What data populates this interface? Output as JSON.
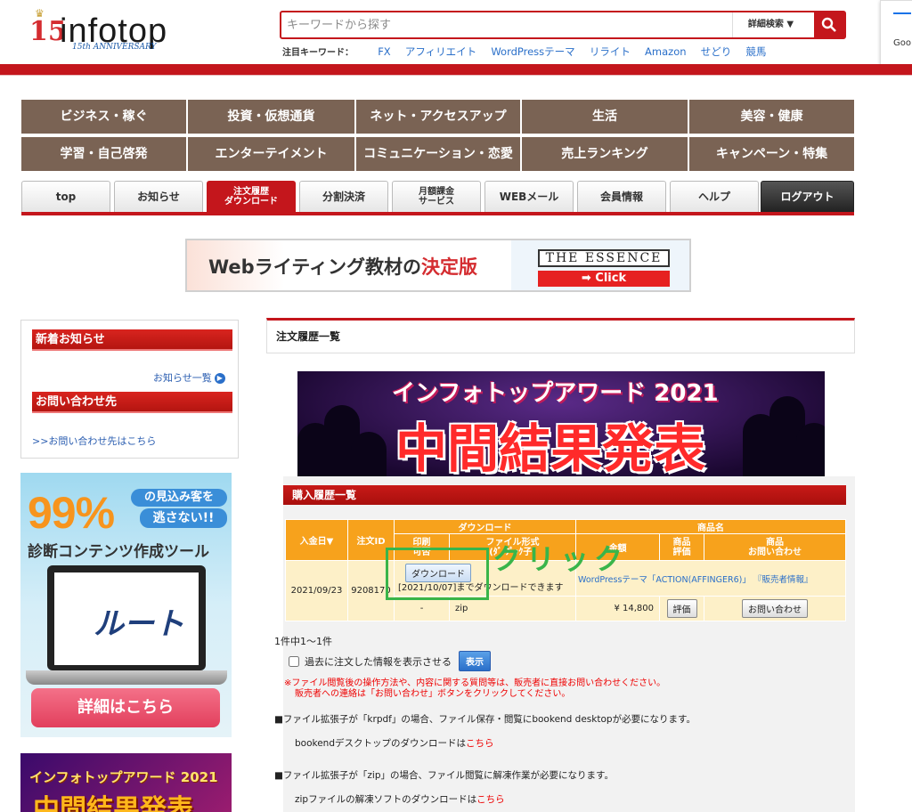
{
  "header": {
    "logo_number": "15",
    "logo_word": "infotop",
    "logo_tagline": "15th ANNIVERSARY",
    "search_placeholder": "キーワードから探す",
    "advanced_search_label": "詳細検索 ▼",
    "keywords_label": "注目キーワード：",
    "keywords": [
      "FX",
      "アフィリエイト",
      "WordPressテーマ",
      "リライト",
      "Amazon",
      "せどり",
      "競馬"
    ],
    "popup_text": "Goo"
  },
  "categories": [
    [
      "ビジネス・稼ぐ",
      "投資・仮想通貨",
      "ネット・アクセスアップ",
      "生活",
      "美容・健康"
    ],
    [
      "学習・自己啓発",
      "エンターテイメント",
      "コミュニケーション・恋愛",
      "売上ランキング",
      "キャンペーン・特集"
    ]
  ],
  "tabs": [
    "top",
    "お知らせ",
    "注文履歴\nダウンロード",
    "分割決済",
    "月額課金\nサービス",
    "WEBメール",
    "会員情報",
    "ヘルプ",
    "ログアウト"
  ],
  "banner": {
    "text_main": "Webライティング教材の",
    "text_red": "決定版",
    "essence": "THE ESSENCE",
    "click": "➡ Click"
  },
  "sidebar": {
    "news_heading": "新着お知らせ",
    "news_link": "お知らせ一覧",
    "contact_heading": "お問い合わせ先",
    "contact_link": ">>お問い合わせ先はこちら"
  },
  "ad1": {
    "big": "99%",
    "line1": "の見込み客を",
    "line2": "逃さない!!",
    "tool": "診断コンテンツ作成ツール",
    "product": "ルート",
    "cta": "詳細はこちら"
  },
  "ad2": {
    "line1": "インフォトップアワード 2021",
    "line2": "中間結果発表"
  },
  "main": {
    "heading": "注文履歴一覧",
    "award_line1": "インフォトップアワード 2021",
    "award_line2": "中間結果発表",
    "panel_heading": "購入履歴一覧",
    "table": {
      "h_date": "入金日▼",
      "h_order": "注文ID",
      "h_download": "ダウンロード",
      "h_product": "商品名",
      "h_print": "印刷\n可否",
      "h_format": "ファイル形式\n(ﾀﾞ ﾌﾟｯｸ子)",
      "h_price": "金額",
      "h_review": "商品\n評価",
      "h_contact": "商品\nお問い合わせ",
      "date": "2021/09/23",
      "order_id": "9208170",
      "download_button": "ダウンロード",
      "download_until": "[2021/10/07]までダウンロードできます",
      "product_name": "WordPressテーマ「ACTION(AFFINGER6)」",
      "seller_info": "『販売者情報』",
      "print": "-",
      "format": "zip",
      "price": "¥ 14,800",
      "review_button": "評価",
      "contact_button": "お問い合わせ"
    },
    "annotation": "クリック",
    "pagination": "1件中1〜1件",
    "past_checkbox_label": "過去に注文した情報を表示させる",
    "show_button": "表示",
    "note_line1": "※ファイル閲覧後の操作方法や、内容に関する質問等は、販売者に直接お問い合わせください。",
    "note_line2": "販売者への連絡は「お問い合わせ」ボタンをクリックしてください。",
    "info1": "■ファイル拡張子が「krpdf」の場合、ファイル保存・閲覧にbookend desktopが必要になります。",
    "info1_sub": "bookendデスクトップのダウンロードは",
    "info2": "■ファイル拡張子が「zip」の場合、ファイル閲覧に解凍作業が必要になります。",
    "info2_sub": "zipファイルの解凍ソフトのダウンロードは",
    "here": "こちら"
  }
}
